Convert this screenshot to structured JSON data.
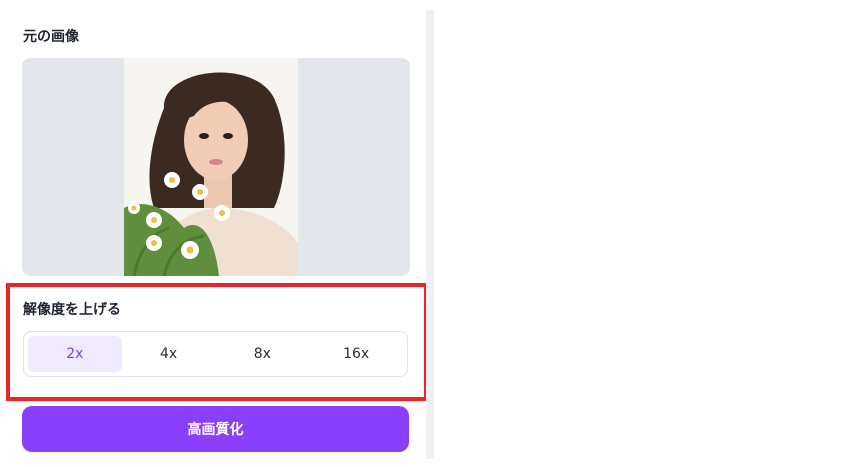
{
  "original_section": {
    "title": "元の画像"
  },
  "upscale_section": {
    "title": "解像度を上げる"
  },
  "scale_options": [
    {
      "label": "2x",
      "selected": true
    },
    {
      "label": "4x",
      "selected": false
    },
    {
      "label": "8x",
      "selected": false
    },
    {
      "label": "16x",
      "selected": false
    }
  ],
  "action_button": {
    "label": "高画質化"
  },
  "colors": {
    "accent": "#8a3ffc",
    "highlight": "#e8262a"
  }
}
